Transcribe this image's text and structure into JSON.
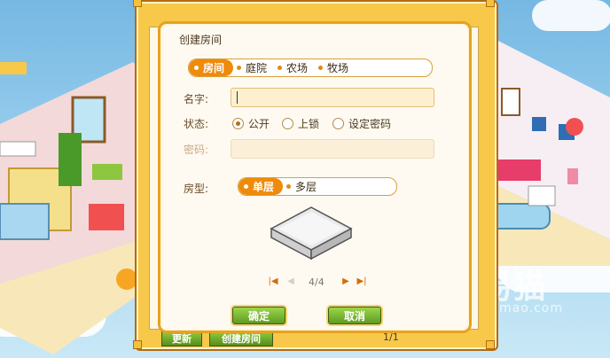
{
  "dialog": {
    "title": "创建房间",
    "room_tabs": [
      {
        "label": "房间",
        "active": true
      },
      {
        "label": "庭院",
        "active": false
      },
      {
        "label": "农场",
        "active": false
      },
      {
        "label": "牧场",
        "active": false
      }
    ],
    "name_label": "名字:",
    "name_value": "",
    "status_label": "状态:",
    "status_options": [
      {
        "label": "公开",
        "selected": true
      },
      {
        "label": "上锁",
        "selected": false
      },
      {
        "label": "设定密码",
        "selected": false
      }
    ],
    "password_label": "密码:",
    "password_value": "",
    "room_type_label": "房型:",
    "room_type_tabs": [
      {
        "label": "单层",
        "active": true
      },
      {
        "label": "多层",
        "active": false
      }
    ],
    "page_indicator": "4/4",
    "confirm_label": "确定",
    "cancel_label": "取消"
  },
  "background_buttons": {
    "refresh_label": "更新",
    "create_room_label": "创建房间",
    "page_indicator": "1/1"
  },
  "watermark": {
    "brand": "易猫",
    "url": "jiaoyimao.com"
  },
  "colors": {
    "accent_orange": "#f08a0a",
    "frame_gold": "#f7c84a",
    "button_green": "#6aa82a"
  }
}
